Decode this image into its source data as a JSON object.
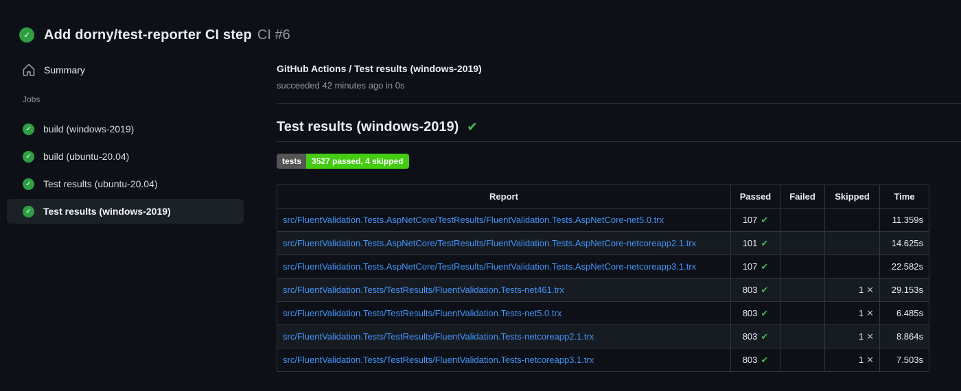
{
  "header": {
    "title": "Add dorny/test-reporter CI step",
    "run_number": "CI #6"
  },
  "sidebar": {
    "summary_label": "Summary",
    "jobs_label": "Jobs",
    "jobs": [
      {
        "label": "build (windows-2019)",
        "selected": false
      },
      {
        "label": "build (ubuntu-20.04)",
        "selected": false
      },
      {
        "label": "Test results (ubuntu-20.04)",
        "selected": false
      },
      {
        "label": "Test results (windows-2019)",
        "selected": true
      }
    ]
  },
  "main": {
    "breadcrumb": "GitHub Actions / Test results (windows-2019)",
    "status_line": "succeeded 42 minutes ago in 0s",
    "section_title": "Test results (windows-2019)",
    "badge": {
      "label": "tests",
      "value": "3527 passed, 4 skipped"
    },
    "table": {
      "columns": [
        "Report",
        "Passed",
        "Failed",
        "Skipped",
        "Time"
      ],
      "rows": [
        {
          "report": "src/FluentValidation.Tests.AspNetCore/TestResults/FluentValidation.Tests.AspNetCore-net5.0.trx",
          "passed": "107",
          "failed": "",
          "skipped": "",
          "time": "11.359s"
        },
        {
          "report": "src/FluentValidation.Tests.AspNetCore/TestResults/FluentValidation.Tests.AspNetCore-netcoreapp2.1.trx",
          "passed": "101",
          "failed": "",
          "skipped": "",
          "time": "14.625s"
        },
        {
          "report": "src/FluentValidation.Tests.AspNetCore/TestResults/FluentValidation.Tests.AspNetCore-netcoreapp3.1.trx",
          "passed": "107",
          "failed": "",
          "skipped": "",
          "time": "22.582s"
        },
        {
          "report": "src/FluentValidation.Tests/TestResults/FluentValidation.Tests-net461.trx",
          "passed": "803",
          "failed": "",
          "skipped": "1",
          "time": "29.153s"
        },
        {
          "report": "src/FluentValidation.Tests/TestResults/FluentValidation.Tests-net5.0.trx",
          "passed": "803",
          "failed": "",
          "skipped": "1",
          "time": "6.485s"
        },
        {
          "report": "src/FluentValidation.Tests/TestResults/FluentValidation.Tests-netcoreapp2.1.trx",
          "passed": "803",
          "failed": "",
          "skipped": "1",
          "time": "8.864s"
        },
        {
          "report": "src/FluentValidation.Tests/TestResults/FluentValidation.Tests-netcoreapp3.1.trx",
          "passed": "803",
          "failed": "",
          "skipped": "1",
          "time": "7.503s"
        }
      ]
    }
  },
  "icons": {
    "status_check": "✓",
    "pass_check": "✔",
    "skip_x": "✕",
    "heading_check": "✔"
  },
  "colors": {
    "success_fill": "#2ea043",
    "check_green": "#3fb950",
    "link_blue": "#4493f8",
    "badge_green": "#44cc11",
    "badge_grey": "#555555",
    "background": "#0d1117",
    "selected_item_bg": "#1c2128",
    "table_border": "#30363d"
  }
}
